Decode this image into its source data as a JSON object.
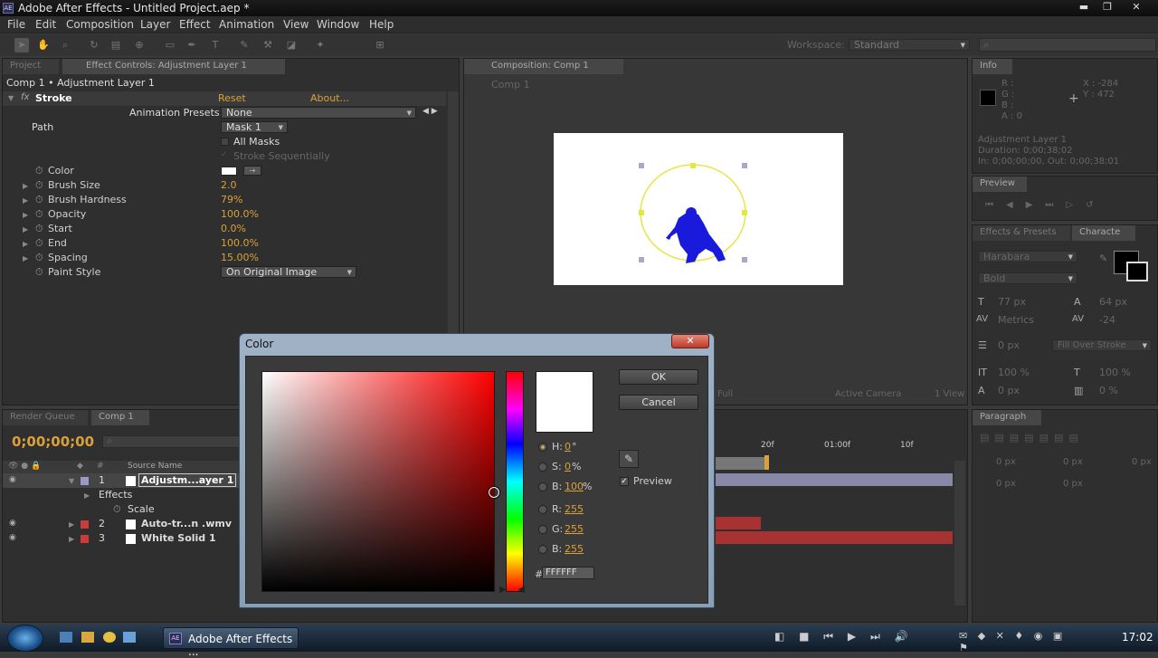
{
  "window": {
    "title": "Adobe After Effects - Untitled Project.aep *",
    "logo": "AE"
  },
  "menu": [
    "File",
    "Edit",
    "Composition",
    "Layer",
    "Effect",
    "Animation",
    "View",
    "Window",
    "Help"
  ],
  "workspace": {
    "label": "Workspace:",
    "value": "Standard"
  },
  "left_panel": {
    "tabs": [
      "Project",
      "Effect Controls: Adjustment Layer 1"
    ],
    "breadcrumb": "Comp 1 • Adjustment Layer 1",
    "effect": {
      "name": "Stroke",
      "reset": "Reset",
      "about": "About...",
      "fx": "fx"
    },
    "presets": {
      "label": "Animation Presets:",
      "value": "None"
    },
    "path": {
      "label": "Path",
      "value": "Mask 1"
    },
    "all_masks": "All Masks",
    "stroke_seq": "Stroke Sequentially",
    "props": [
      {
        "name": "Color",
        "value": ""
      },
      {
        "name": "Brush Size",
        "value": "2.0"
      },
      {
        "name": "Brush Hardness",
        "value": "79%"
      },
      {
        "name": "Opacity",
        "value": "100.0%"
      },
      {
        "name": "Start",
        "value": "0.0%"
      },
      {
        "name": "End",
        "value": "100.0%"
      },
      {
        "name": "Spacing",
        "value": "15.00%"
      }
    ],
    "paint_style": {
      "label": "Paint Style",
      "value": "On Original Image"
    }
  },
  "comp_panel": {
    "tab": "Composition: Comp 1",
    "sub": "Comp 1",
    "bottom": {
      "quality": "Full",
      "camera": "Active Camera",
      "view": "1 View"
    }
  },
  "info": {
    "tab": "Info",
    "r": "R :",
    "g": "G :",
    "b": "B :",
    "a": "A : 0",
    "x": "X : -284",
    "y": "Y : 472",
    "layer": "Adjustment Layer 1",
    "duration": "Duration: 0;00;38;02",
    "inout": "In: 0;00;00;00, Out: 0;00;38;01"
  },
  "preview_tab": "Preview",
  "effects_tab": "Effects & Presets",
  "char_tab": "Characte",
  "character": {
    "font": "Harabara",
    "style": "Bold",
    "size": "77 px",
    "leading": "64 px",
    "kerning": "Metrics",
    "tracking": "-24",
    "stroke": "0 px",
    "stroke_mode": "Fill Over Stroke",
    "vscale": "100 %",
    "hscale": "100 %",
    "baseline": "0 px",
    "tsume": "0 %"
  },
  "paragraph": {
    "tab": "Paragraph",
    "indent": [
      "0 px",
      "0 px",
      "0 px",
      "0 px",
      "0 px"
    ]
  },
  "timeline": {
    "tabs": [
      "Render Queue",
      "Comp 1"
    ],
    "time": "0;00;00;00",
    "col_source": "Source Name",
    "ruler": [
      "20f",
      "01:00f",
      "10f"
    ],
    "layers": [
      {
        "num": "1",
        "name": "Adjustm...ayer 1",
        "color": "#9a9ac8"
      },
      {
        "num": "2",
        "name": "Auto-tr...n .wmv",
        "color": "#c83c3c"
      },
      {
        "num": "3",
        "name": "White Solid 1",
        "color": "#c83c3c"
      }
    ],
    "effects_label": "Effects",
    "scale_label": "Scale"
  },
  "dialog": {
    "title": "Color",
    "ok": "OK",
    "cancel": "Cancel",
    "h_label": "H:",
    "h": "0",
    "h_unit": "°",
    "s_label": "S:",
    "s": "0",
    "s_unit": "%",
    "b_label": "B:",
    "b": "100",
    "b_unit": "%",
    "r_label": "R:",
    "r": "255",
    "g_label": "G:",
    "g": "255",
    "b2_label": "B:",
    "b2": "255",
    "hex": "FFFFFF",
    "hash": "#",
    "preview": "Preview",
    "current_color": "#ffffff"
  },
  "taskbar": {
    "app": "Adobe After Effects ...",
    "clock": "17:02"
  }
}
